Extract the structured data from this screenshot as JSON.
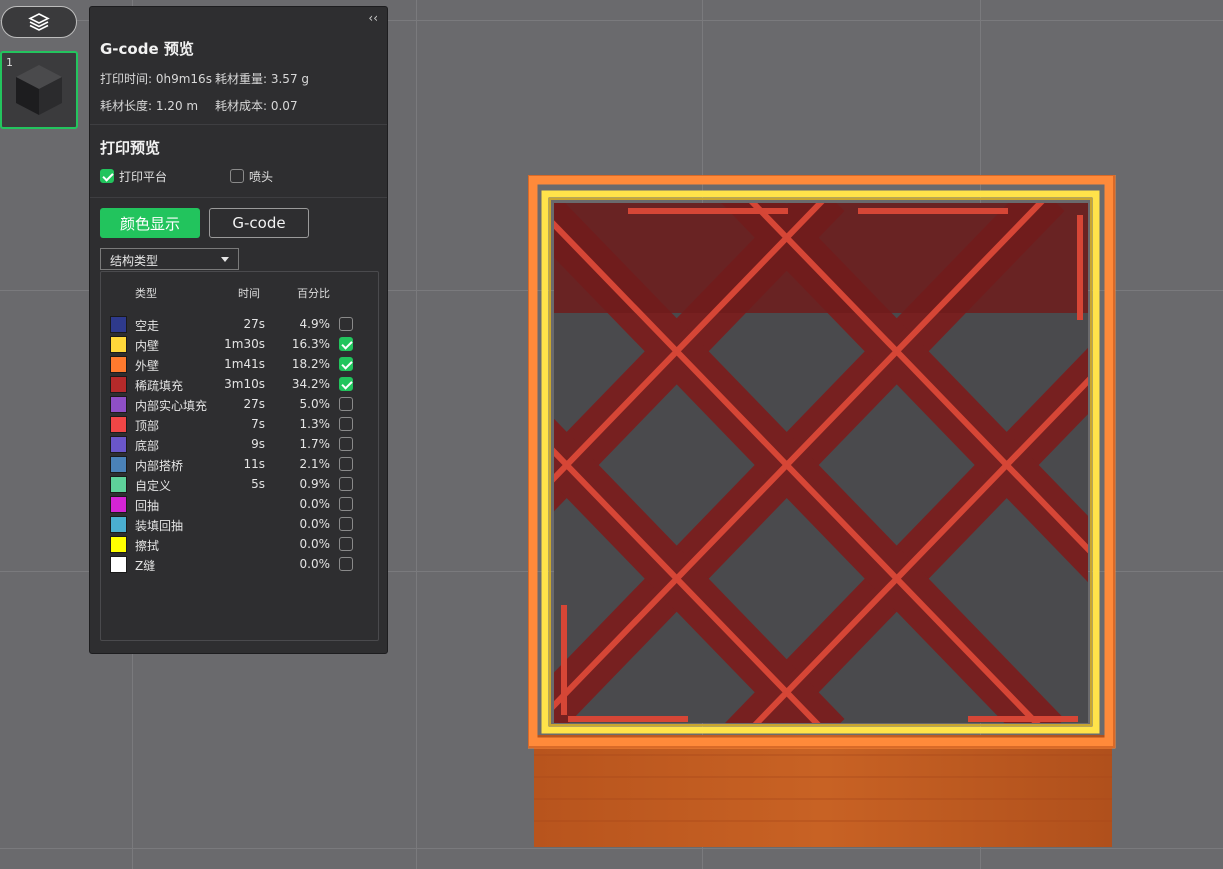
{
  "panel": {
    "collapse_label": "‹‹",
    "title": "G-code 预览",
    "stats": {
      "print_time": "打印时间: 0h9m16s",
      "filament_weight": "耗材重量: 3.57 g",
      "filament_length": "耗材长度: 1.20 m",
      "filament_cost": "耗材成本: 0.07"
    },
    "preview_section": {
      "title": "打印预览",
      "show_bed_label": "打印平台",
      "show_bed_checked": true,
      "show_nozzle_label": "喷头",
      "show_nozzle_checked": false
    },
    "mode_buttons": {
      "color_label": "颜色显示",
      "gcode_label": "G-code"
    },
    "view_type": {
      "selected": "结构类型"
    },
    "legend": {
      "headers": {
        "type": "类型",
        "time": "时间",
        "percent": "百分比"
      },
      "rows": [
        {
          "name": "空走",
          "time": "27s",
          "percent": "4.9%",
          "color": "#2e3a8c",
          "checked": false
        },
        {
          "name": "内壁",
          "time": "1m30s",
          "percent": "16.3%",
          "color": "#ffd83a",
          "checked": true
        },
        {
          "name": "外壁",
          "time": "1m41s",
          "percent": "18.2%",
          "color": "#ff7a2e",
          "checked": true
        },
        {
          "name": "稀疏填充",
          "time": "3m10s",
          "percent": "34.2%",
          "color": "#b52a2a",
          "checked": true
        },
        {
          "name": "内部实心填充",
          "time": "27s",
          "percent": "5.0%",
          "color": "#8e4fc6",
          "checked": false
        },
        {
          "name": "顶部",
          "time": "7s",
          "percent": "1.3%",
          "color": "#f04646",
          "checked": false
        },
        {
          "name": "底部",
          "time": "9s",
          "percent": "1.7%",
          "color": "#6a56c9",
          "checked": false
        },
        {
          "name": "内部搭桥",
          "time": "11s",
          "percent": "2.1%",
          "color": "#4a82b8",
          "checked": false
        },
        {
          "name": "自定义",
          "time": "5s",
          "percent": "0.9%",
          "color": "#5ed19a",
          "checked": false
        },
        {
          "name": "回抽",
          "time": "",
          "percent": "0.0%",
          "color": "#d424d4",
          "checked": false
        },
        {
          "name": "装填回抽",
          "time": "",
          "percent": "0.0%",
          "color": "#4aaed0",
          "checked": false
        },
        {
          "name": "擦拭",
          "time": "",
          "percent": "0.0%",
          "color": "#ffff00",
          "checked": false
        },
        {
          "name": "Z缝",
          "time": "",
          "percent": "0.0%",
          "color": "#ffffff",
          "checked": false
        }
      ]
    }
  },
  "plate": {
    "index": "1"
  }
}
